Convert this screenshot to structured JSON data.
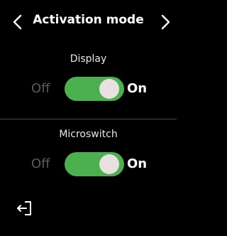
{
  "header": {
    "title": "Activation mode",
    "prev_icon": "chevron-left-icon",
    "next_icon": "chevron-right-icon"
  },
  "settings": [
    {
      "label": "Display",
      "off_label": "Off",
      "on_label": "On",
      "state": "on"
    },
    {
      "label": "Microswitch",
      "off_label": "Off",
      "on_label": "On",
      "state": "on"
    }
  ],
  "footer": {
    "exit_icon": "exit-icon"
  },
  "colors": {
    "background": "#000000",
    "toggle_on": "#4cb04f",
    "knob": "#e9e1e1",
    "off_text": "#5b5b5b",
    "divider": "#4a4a4a"
  }
}
